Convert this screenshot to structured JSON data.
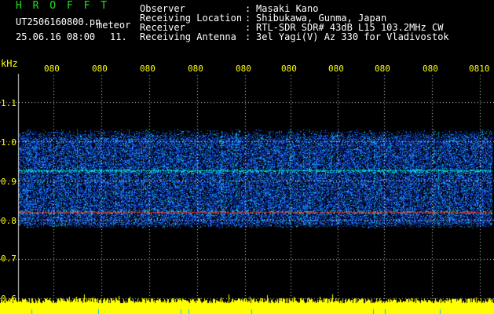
{
  "header": {
    "logo": "H R O F F T",
    "filename": "UT2506160800.pn",
    "tag": "meteor",
    "datetime": "25.06.16 08:00",
    "count": "11.",
    "fields": [
      {
        "label": "Observer",
        "value": "Masaki Kano"
      },
      {
        "label": "Receiving Location",
        "value": "Shibukawa, Gunma, Japan"
      },
      {
        "label": "Receiver",
        "value": "RTL-SDR SDR# 43dB L15 103.2MHz CW"
      },
      {
        "label": "Receiving Antenna",
        "value": "3el Yagi(V) Az 330 for Vladivostok"
      }
    ],
    "colon": ":"
  },
  "chart_data": {
    "type": "heatmap",
    "ylabel": "kHz",
    "y_ticks": [
      "1.1",
      "1.0",
      "0.9",
      "0.8",
      "0.7",
      "0.6"
    ],
    "x_ticks": [
      "080",
      "080",
      "080",
      "080",
      "080",
      "080",
      "080",
      "080",
      "080",
      "0810"
    ],
    "signal_band_khz": [
      0.78,
      1.03
    ],
    "strong_lines_khz": [
      0.82,
      0.925
    ],
    "colors": {
      "background": "#000000",
      "noise_low": "#0a2aa0",
      "noise_mid": "#1e7dff",
      "noise_high": "#00e0d0",
      "peak": "#ff2a2a",
      "grid": "#d8d8d8",
      "bars": "#ffff00",
      "text": "#ffff00"
    }
  }
}
